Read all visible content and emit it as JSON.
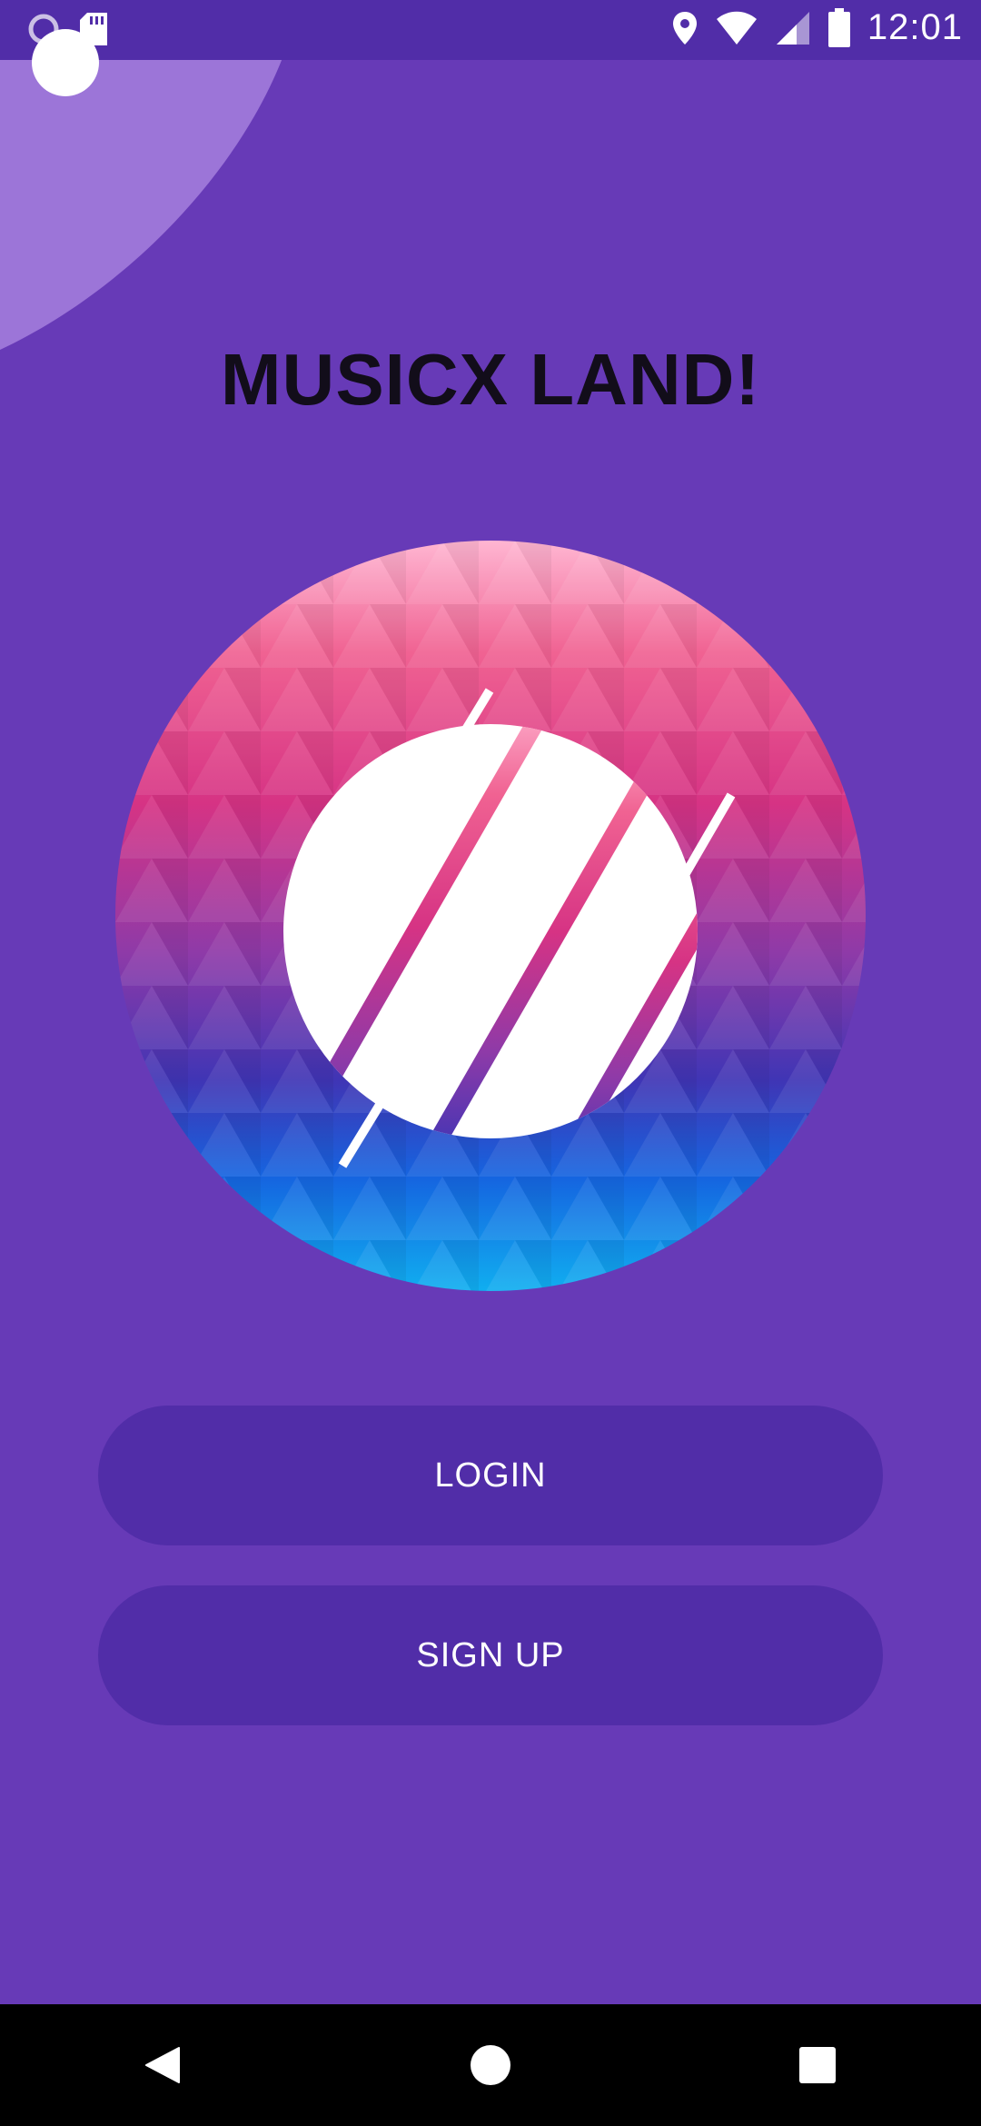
{
  "status_bar": {
    "time": "12:01",
    "icons": [
      "notification-circle-icon",
      "sd-card-icon",
      "location-icon",
      "wifi-icon",
      "signal-icon",
      "battery-icon"
    ]
  },
  "app": {
    "title": "MUSICX LAND!",
    "logo": "musicx-logo"
  },
  "buttons": {
    "login": "LOGIN",
    "signup": "SIGN UP"
  },
  "nav_bar": {
    "icons": [
      "back-icon",
      "home-icon",
      "recents-icon"
    ]
  },
  "colors": {
    "background": "#673ab7",
    "status_bar": "#512da8",
    "button": "#512da8",
    "title": "#120d1a"
  }
}
